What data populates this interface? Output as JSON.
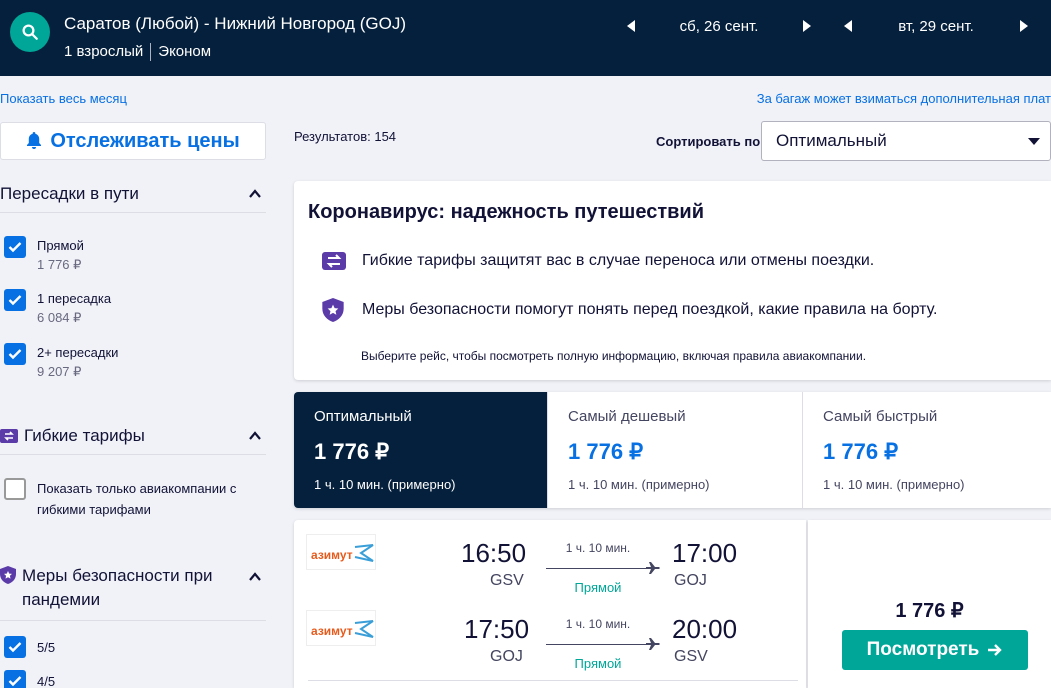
{
  "header": {
    "route": "Саратов (Любой) - Нижний Новгород (GOJ)",
    "passengers": "1 взрослый",
    "cabin": "Эконом",
    "depart_date": "сб, 26 сент.",
    "return_date": "вт, 29 сент."
  },
  "links": {
    "month": "Показать весь месяц",
    "baggage": "За багаж может взиматься дополнительная плат"
  },
  "sidebar": {
    "track_label": "Отслеживать цены",
    "stops": {
      "title": "Пересадки в пути",
      "items": [
        {
          "label": "Прямой",
          "price": "1 776 ₽",
          "checked": true
        },
        {
          "label": "1 пересадка",
          "price": "6 084 ₽",
          "checked": true
        },
        {
          "label": "2+ пересадки",
          "price": "9 207 ₽",
          "checked": true
        }
      ]
    },
    "flex": {
      "title": "Гибкие тарифы",
      "option": "Показать только авиакомпании с гибкими тарифами"
    },
    "safety": {
      "title": "Меры безопасности при пандемии",
      "items": [
        {
          "label": "5/5",
          "checked": true
        },
        {
          "label": "4/5",
          "checked": true
        }
      ]
    }
  },
  "main": {
    "results": "Результатов: 154",
    "sort_label": "Сортировать по",
    "sort_value": "Оптимальный",
    "covid": {
      "title": "Коронавирус: надежность путешествий",
      "line1": "Гибкие тарифы защитят вас в случае переноса или отмены поездки.",
      "line2": "Меры безопасности помогут понять перед поездкой, какие правила на борту.",
      "note": "Выберите рейс, чтобы посмотреть полную информацию, включая правила авиакомпании."
    },
    "tabs": [
      {
        "label": "Оптимальный",
        "price": "1 776 ₽",
        "duration": "1 ч. 10 мин. (примерно)"
      },
      {
        "label": "Самый дешевый",
        "price": "1 776 ₽",
        "duration": "1 ч. 10 мин. (примерно)"
      },
      {
        "label": "Самый быстрый",
        "price": "1 776 ₽",
        "duration": "1 ч. 10 мин. (примерно)"
      }
    ],
    "flight": {
      "airline_logo_text": "азимут",
      "legs": [
        {
          "dep_time": "16:50",
          "dep_code": "GSV",
          "duration": "1 ч. 10 мин.",
          "stops": "Прямой",
          "arr_time": "17:00",
          "arr_code": "GOJ"
        },
        {
          "dep_time": "17:50",
          "dep_code": "GOJ",
          "duration": "1 ч. 10 мин.",
          "stops": "Прямой",
          "arr_time": "20:00",
          "arr_code": "GSV"
        }
      ],
      "price": "1 776 ₽",
      "button": "Посмотреть"
    }
  },
  "colors": {
    "header_bg": "#05203c",
    "accent_blue": "#0770e3",
    "accent_green": "#00a698"
  }
}
